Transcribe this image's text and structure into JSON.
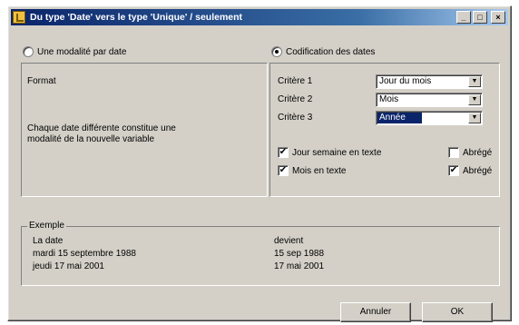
{
  "window": {
    "title": "Du type 'Date' vers le type 'Unique' / seulement",
    "controls": {
      "minimize": "_",
      "maximize": "□",
      "close": "×"
    }
  },
  "options": {
    "modalite_label": "Une modalité par date",
    "modalite_selected": false,
    "codification_label": "Codification des dates",
    "codification_selected": true
  },
  "left_panel": {
    "heading": "Format",
    "description": "Chaque date différente constitue une modalité de la nouvelle variable"
  },
  "right_panel": {
    "criteres": [
      {
        "label": "Critère 1",
        "value": "Jour du mois"
      },
      {
        "label": "Critère 2",
        "value": "Mois"
      },
      {
        "label": "Critère 3",
        "value": "Année"
      }
    ],
    "checkboxes": [
      {
        "label": "Jour semaine en texte",
        "checked": true
      },
      {
        "label": "Abrégé",
        "checked": false
      },
      {
        "label": "Mois en texte",
        "checked": true
      },
      {
        "label": "Abrégé",
        "checked": true
      }
    ]
  },
  "example": {
    "legend": "Exemple",
    "left_header": "La date",
    "left_rows": [
      "mardi 15 septembre 1988",
      "jeudi 17 mai 2001"
    ],
    "right_header": "devient",
    "right_rows": [
      "15 sep 1988",
      "17 mai 2001"
    ]
  },
  "buttons": {
    "cancel": "Annuler",
    "ok": "OK"
  },
  "icons": {
    "dropdown": "▼",
    "check": "✔"
  }
}
